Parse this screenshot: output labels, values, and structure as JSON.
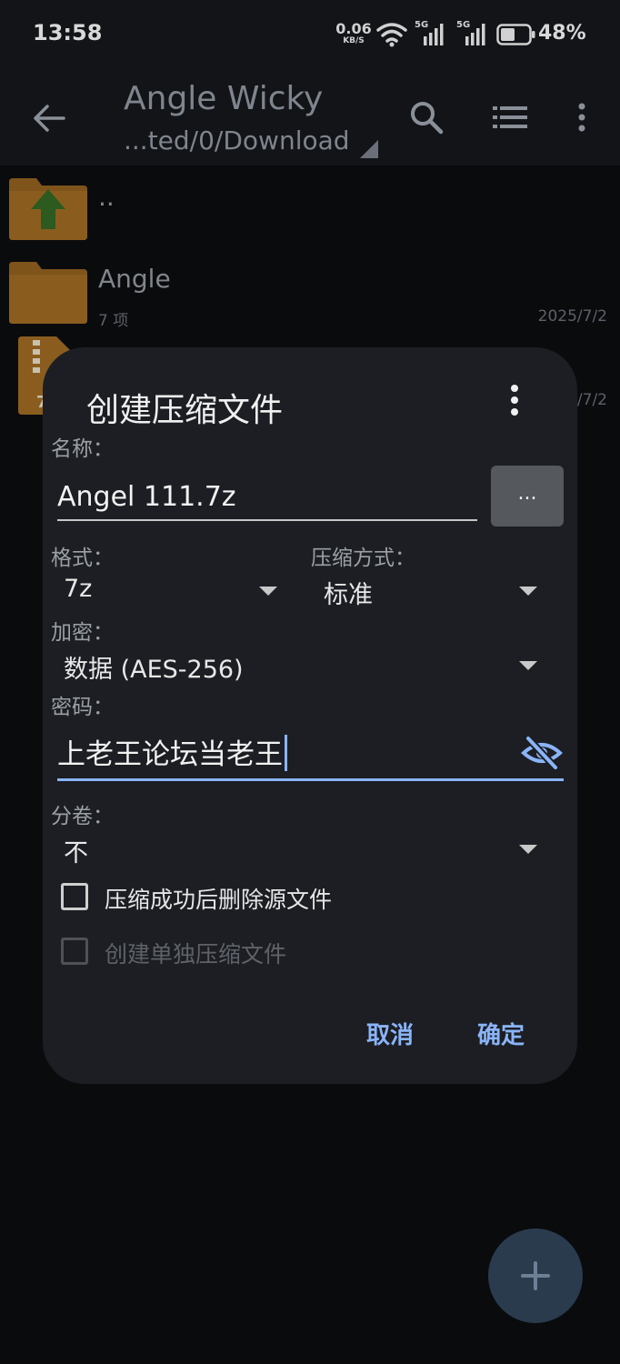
{
  "status_bar": {
    "time": "13:58",
    "net_speed": "0.06",
    "net_unit": "KB/S",
    "sim1": "5G",
    "sim2": "5G",
    "battery": "48%"
  },
  "app_bar": {
    "title": "Angle Wicky",
    "path": "...ted/0/Download"
  },
  "file_list": [
    {
      "name": "..",
      "meta": "",
      "date": ""
    },
    {
      "name": "Angle",
      "meta": "7 项",
      "date": "2025/7/2"
    },
    {
      "name": "",
      "meta": "7",
      "date": "/7/2"
    }
  ],
  "dialog": {
    "title": "创建压缩文件",
    "name_label": "名称：",
    "name_value": "Angel 111.7z",
    "browse_label": "...",
    "format_label": "格式：",
    "format_value": "7z",
    "method_label": "压缩方式：",
    "method_value": "标准",
    "encryption_label": "加密：",
    "encryption_value": "数据 (AES-256)",
    "password_label": "密码：",
    "password_value": "上老王论坛当老王",
    "split_label": "分卷：",
    "split_value": "不",
    "delete_source_label": "压缩成功后删除源文件",
    "delete_source_checked": false,
    "separate_label": "创建单独压缩文件",
    "separate_checked": false,
    "cancel_label": "取消",
    "ok_label": "确定"
  },
  "colors": {
    "accent": "#8ab4f8",
    "dialog_bg": "#1c1e23",
    "folder": "#e08a1e",
    "up_arrow": "#3f8a2a"
  }
}
